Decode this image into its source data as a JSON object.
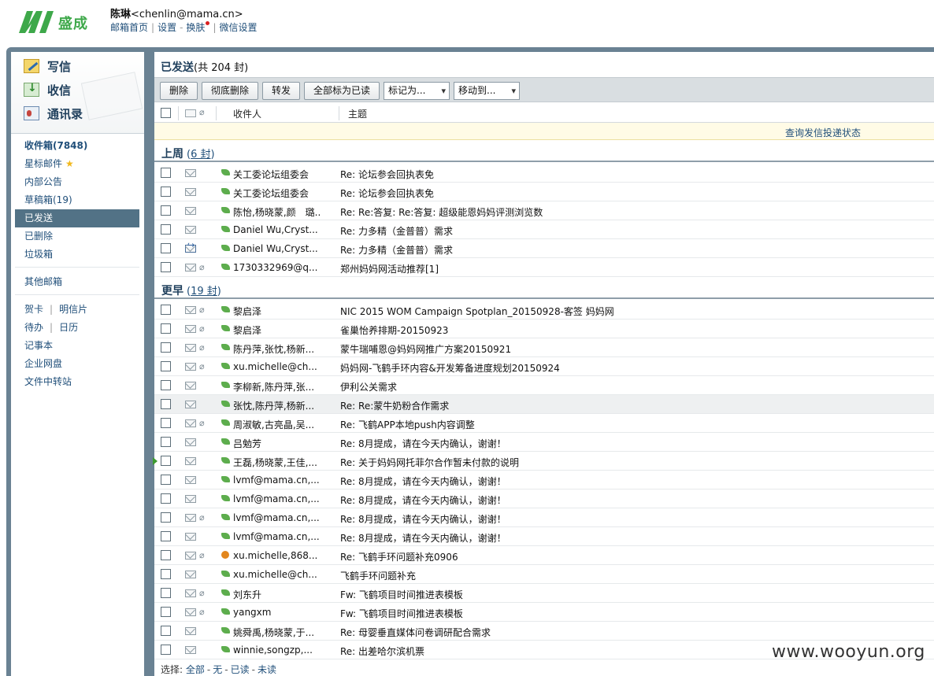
{
  "header": {
    "logo_text": "盛成",
    "user_name": "陈琳",
    "user_email": "<chenlin@mama.cn>",
    "links": [
      "邮箱首页",
      "设置",
      "换肤",
      "微信设置"
    ],
    "link_sep_1": "|",
    "link_sep_2": "-",
    "link_sep_3": "|"
  },
  "sidebar": {
    "actions": [
      "写信",
      "收信",
      "通讯录"
    ],
    "inbox": "收件箱(7848)",
    "starred": "星标邮件",
    "notice": "内部公告",
    "drafts": "草稿箱(19)",
    "sent": "已发送",
    "deleted": "已删除",
    "junk": "垃圾箱",
    "other": "其他邮箱",
    "card": "贺卡",
    "postcard": "明信片",
    "todo": "待办",
    "calendar": "日历",
    "notes": "记事本",
    "netdisk": "企业网盘",
    "transfer": "文件中转站",
    "pipe": "|",
    "star_icon": "★"
  },
  "main": {
    "title": "已发送",
    "count": "(共 204 封)",
    "toolbar": {
      "delete": "删除",
      "perm_delete": "彻底删除",
      "forward": "转发",
      "mark_all_read": "全部标为已读",
      "mark_as": "标记为...",
      "move_to": "移动到..."
    },
    "columns": {
      "recipient": "收件人",
      "subject": "主题"
    },
    "query_status": "查询发信投递状态",
    "group1": {
      "label": "上周",
      "count": "(6 封)",
      "count_num": "6 封"
    },
    "group2": {
      "label": "更早",
      "count": "(19 封)",
      "count_num": "19 封"
    },
    "rows1": [
      {
        "to": "关工委论坛组委会",
        "subj": "Re: 论坛参会回执表免"
      },
      {
        "to": "关工委论坛组委会",
        "subj": "Re: 论坛参会回执表免"
      },
      {
        "to": "陈怡,杨晓蒙,颜　璐...",
        "subj": "Re: Re:答复: Re:答复: 超级能恩妈妈评测浏览数"
      },
      {
        "to": "Daniel Wu,Cryst...",
        "subj": "Re: 力多精（金普普）需求"
      },
      {
        "to": "Daniel Wu,Cryst...",
        "subj": "Re: 力多精（金普普）需求"
      },
      {
        "to": "1730332969@q...",
        "subj": "郑州妈妈网活动推荐[1]"
      }
    ],
    "rows2": [
      {
        "to": "黎启泽",
        "subj": "NIC 2015 WOM Campaign Spotplan_20150928-客签 妈妈网"
      },
      {
        "to": "黎启泽",
        "subj": "雀巢怡养排期-20150923"
      },
      {
        "to": "陈丹萍,张忱,杨新...",
        "subj": "蒙牛瑞哺恩@妈妈网推广方案20150921"
      },
      {
        "to": "xu.michelle@ch...",
        "subj": "妈妈网-飞鹤手环内容&开发筹备进度规划20150924"
      },
      {
        "to": "李柳新,陈丹萍,张...",
        "subj": "伊利公关需求"
      },
      {
        "to": "张忱,陈丹萍,杨新...",
        "subj": "Re: Re:蒙牛奶粉合作需求"
      },
      {
        "to": "周淑敏,古亮晶,吴...",
        "subj": "Re: 飞鹤APP本地push内容调整"
      },
      {
        "to": "吕勉芳",
        "subj": "Re: 8月提成，请在今天内确认，谢谢！"
      },
      {
        "to": "王磊,杨晓蒙,王佳,...",
        "subj": "Re: 关于妈妈网托菲尔合作暂未付款的说明"
      },
      {
        "to": "lvmf@mama.cn,...",
        "subj": "Re: 8月提成，请在今天内确认，谢谢！"
      },
      {
        "to": "lvmf@mama.cn,...",
        "subj": "Re: 8月提成，请在今天内确认，谢谢！"
      },
      {
        "to": "lvmf@mama.cn,...",
        "subj": "Re: 8月提成，请在今天内确认，谢谢！"
      },
      {
        "to": "lvmf@mama.cn,...",
        "subj": "Re: 8月提成，请在今天内确认，谢谢！"
      },
      {
        "to": "xu.michelle,868...",
        "subj": "Re: 飞鹤手环问题补充0906"
      },
      {
        "to": "xu.michelle@ch...",
        "subj": "飞鹤手环问题补充"
      },
      {
        "to": "刘东升",
        "subj": "Fw: 飞鹤项目时间推进表模板"
      },
      {
        "to": "yangxm",
        "subj": "Fw: 飞鹤项目时间推进表模板"
      },
      {
        "to": "姚舜禹,杨晓蒙,于...",
        "subj": "Re: 母婴垂直媒体问卷调研配合需求"
      },
      {
        "to": "winnie,songzp,...",
        "subj": "Re: 出差哈尔滨机票"
      }
    ],
    "select": {
      "label": "选择:",
      "all": "全部",
      "none": "无",
      "read": "已读",
      "unread": "未读",
      "dash": "-"
    }
  },
  "watermark": "www.wooyun.org",
  "colors": {
    "accent_green": "#3ea84a",
    "frame": "#6a8293",
    "active_folder": "#527286"
  }
}
